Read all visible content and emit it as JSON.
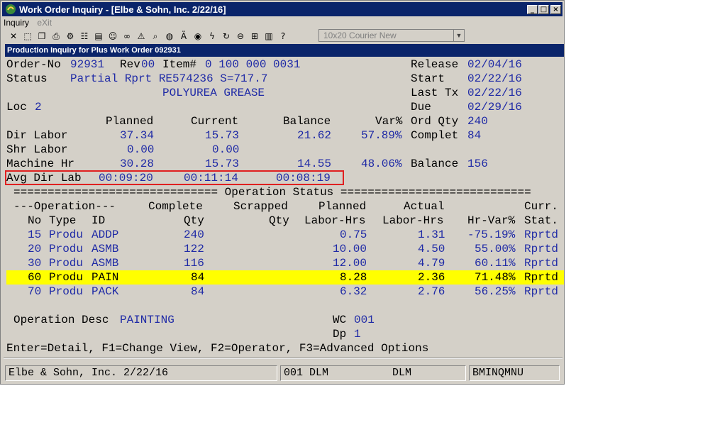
{
  "window": {
    "title": "Work Order Inquiry - [Elbe & Sohn, Inc. 2/22/16]",
    "minimize": "_",
    "maximize": "□",
    "close": "×"
  },
  "menu": {
    "inquiry": "Inquiry",
    "exit": "eXit"
  },
  "toolbar": {
    "font_select": "10x20 Courier New",
    "icons": [
      "close-icon",
      "select-icon",
      "copy-icon",
      "print-icon",
      "settings-icon",
      "options-icon",
      "notes-icon",
      "lookup-icon",
      "binoculars-icon",
      "warning-icon",
      "search-icon",
      "globe-icon",
      "font-icon",
      "camera-icon",
      "lightning-icon",
      "refresh-icon",
      "link-icon",
      "calculator-icon",
      "document-icon",
      "help-icon"
    ]
  },
  "screen_header": "Production Inquiry for Plus Work Order 092931",
  "order": {
    "order_no_label": "Order-No",
    "order_no": "92931",
    "rev_label": "Rev",
    "rev": "00",
    "item_label": "Item#",
    "item": "0 100 000 0031",
    "status_label": "Status",
    "status": "Partial Rprt RE574236 S=717.7",
    "description": "POLYUREA GREASE",
    "loc_label": "Loc",
    "loc": "2",
    "release_label": "Release",
    "release": "02/04/16",
    "start_label": "Start",
    "start": "02/22/16",
    "last_tx_label": "Last Tx",
    "last_tx": "02/22/16",
    "due_label": "Due",
    "due": "02/29/16"
  },
  "labor": {
    "col_planned": "Planned",
    "col_current": "Current",
    "col_balance": "Balance",
    "col_var": "Var%",
    "ord_qty_label": "Ord Qty",
    "ord_qty": "240",
    "complete_label": "Complet",
    "complete": "84",
    "balance_label": "Balance",
    "balance": "156",
    "rows": [
      {
        "label": "Dir Labor",
        "planned": "37.34",
        "current": "15.73",
        "balance": "21.62",
        "var": "57.89%"
      },
      {
        "label": "Shr Labor",
        "planned": "0.00",
        "current": "0.00",
        "balance": "",
        "var": ""
      },
      {
        "label": "Machine Hr",
        "planned": "30.28",
        "current": "15.73",
        "balance": "14.55",
        "var": "48.06%"
      },
      {
        "label": "Avg Dir Lab",
        "planned": "00:09:20",
        "current": "00:11:14",
        "balance": "00:08:19",
        "var": ""
      }
    ]
  },
  "ops": {
    "divider": "============================== Operation Status ============================",
    "h1_operation": "---Operation---",
    "h1_complete": "Complete",
    "h1_scrapped": "Scrapped",
    "h1_planned": "Planned",
    "h1_actual": "Actual",
    "h1_curr": "Curr.",
    "h2_no": "No",
    "h2_type": "Type",
    "h2_id": "ID",
    "h2_qty": "Qty",
    "h2_sqty": "Qty",
    "h2_plabor": "Labor-Hrs",
    "h2_alabor": "Labor-Hrs",
    "h2_hrvar": "Hr-Var%",
    "h2_stat": "Stat.",
    "rows": [
      {
        "no": "15",
        "type": "Produ",
        "id": "ADDP",
        "qty": "240",
        "scrap": "",
        "planned": "0.75",
        "actual": "1.31",
        "var": "-75.19%",
        "stat": "Rprtd"
      },
      {
        "no": "20",
        "type": "Produ",
        "id": "ASMB",
        "qty": "122",
        "scrap": "",
        "planned": "10.00",
        "actual": "4.50",
        "var": "55.00%",
        "stat": "Rprtd"
      },
      {
        "no": "30",
        "type": "Produ",
        "id": "ASMB",
        "qty": "116",
        "scrap": "",
        "planned": "12.00",
        "actual": "4.79",
        "var": "60.11%",
        "stat": "Rprtd"
      },
      {
        "no": "60",
        "type": "Produ",
        "id": "PAIN",
        "qty": "84",
        "scrap": "",
        "planned": "8.28",
        "actual": "2.36",
        "var": "71.48%",
        "stat": "Rprtd"
      },
      {
        "no": "70",
        "type": "Produ",
        "id": "PACK",
        "qty": "84",
        "scrap": "",
        "planned": "6.32",
        "actual": "2.76",
        "var": "56.25%",
        "stat": "Rprtd"
      }
    ],
    "selected_index": 3,
    "op_desc_label": "Operation Desc",
    "op_desc": "PAINTING",
    "wc_label": "WC",
    "wc": "001",
    "dp_label": "Dp",
    "dp": "1"
  },
  "footer_keys": "Enter=Detail, F1=Change View, F2=Operator, F3=Advanced Options",
  "status_bar": {
    "company": "Elbe & Sohn, Inc. 2/22/16",
    "operator": "001 DLM          DLM",
    "program": "BMINQMNU"
  },
  "colors": {
    "title_bar": "#0a246a",
    "value_text": "#1f2aa6",
    "highlight_row": "#ffff00",
    "annotation_box": "#e02020",
    "window_bg": "#d4d0c8"
  }
}
